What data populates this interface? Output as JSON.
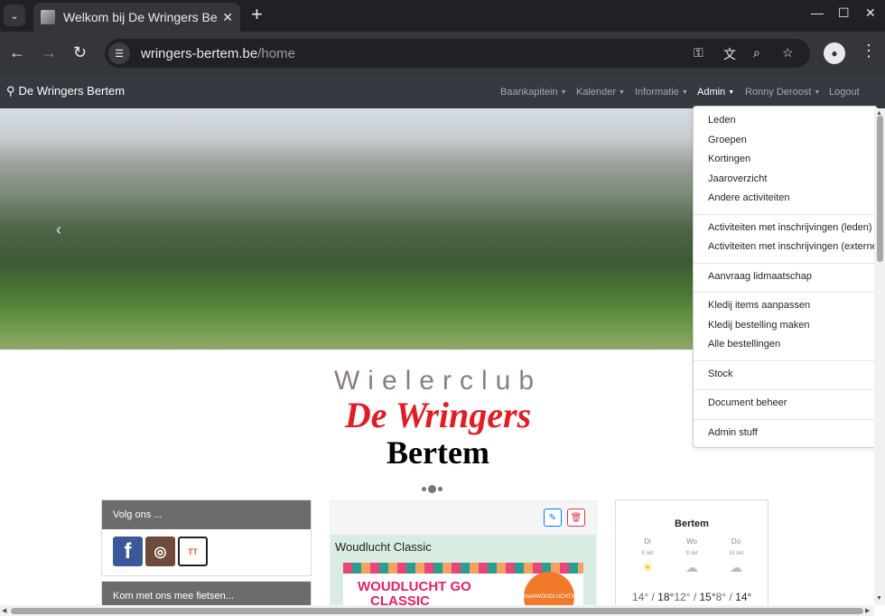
{
  "browser": {
    "tab_title": "Welkom bij De Wringers Bertem",
    "url_host": "wringers-bertem.be",
    "url_path": "/home",
    "new_tab": "+",
    "close": "✕"
  },
  "navbar": {
    "brand": "De Wringers Bertem",
    "items": [
      {
        "label": "Baankapitein"
      },
      {
        "label": "Kalender"
      },
      {
        "label": "Informatie"
      },
      {
        "label": "Admin"
      },
      {
        "label": "Ronny Deroost"
      },
      {
        "label": "Logout"
      }
    ]
  },
  "admin_menu": {
    "group1": [
      "Leden",
      "Groepen",
      "Kortingen",
      "Jaaroverzicht",
      "Andere activiteiten"
    ],
    "group2": [
      "Activiteiten met inschrijvingen (leden)",
      "Activiteiten met inschrijvingen (externen)"
    ],
    "group3": [
      "Aanvraag lidmaatschap"
    ],
    "group4": [
      "Kledij items aanpassen",
      "Kledij bestelling maken",
      "Alle bestellingen"
    ],
    "group5": [
      "Stock"
    ],
    "group6": [
      "Document beheer"
    ],
    "group7": [
      "Admin stuff"
    ]
  },
  "logo": {
    "line1": "Wielerclub",
    "line2": "De Wringers",
    "line3": "Bertem"
  },
  "sidebar": {
    "follow_title": "Volg ons ...",
    "ride_title": "Kom met ons mee fietsen..."
  },
  "news": {
    "title": "Woudlucht Classic",
    "image_text1": "WOUDLUCHT GO",
    "image_text2": "CLASSIC",
    "image_badge": "StreekWOUDLUCHT.be"
  },
  "weather": {
    "city": "Bertem",
    "days": [
      {
        "day": "Di",
        "date": "8 okt",
        "low": "14°",
        "high": "18°",
        "icon": "sun-rain-icon"
      },
      {
        "day": "Wo",
        "date": "9 okt",
        "low": "12°",
        "high": "15°",
        "icon": "rain-icon"
      },
      {
        "day": "Do",
        "date": "10 okt",
        "low": "8°",
        "high": "14°",
        "icon": "rain-icon"
      }
    ]
  },
  "colors": {
    "navbar_bg": "#343a40",
    "logo_red": "#e31b23",
    "facebook": "#3b5998"
  }
}
